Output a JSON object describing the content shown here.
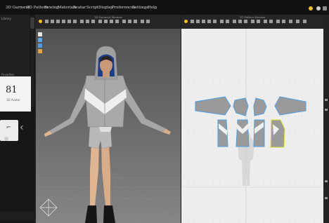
{
  "menu": [
    {
      "id": "3d-garment",
      "label": "3D Garment"
    },
    {
      "id": "2d-pattern",
      "label": "2D Pattern"
    },
    {
      "id": "sewing",
      "label": "Sewing"
    },
    {
      "id": "materials",
      "label": "Materials"
    },
    {
      "id": "avatar",
      "label": "Avatar"
    },
    {
      "id": "scripts",
      "label": "Script"
    },
    {
      "id": "display",
      "label": "Display"
    },
    {
      "id": "preferences",
      "label": "Preferences"
    },
    {
      "id": "settings",
      "label": "Settings"
    },
    {
      "id": "help",
      "label": "Help"
    }
  ],
  "left_panel": {
    "label_1": "Library",
    "label_2": "Favorites",
    "card_value": "81",
    "card_caption": "3D Avatar",
    "thumb_glyph": "⌐"
  },
  "window_3d": {
    "title": "3D Garment Window"
  },
  "window_2d": {
    "title": "2D Pattern Window"
  },
  "colors": {
    "accent_yellow": "#f2c01e",
    "selection_blue": "#4a9ee6",
    "pattern_fill": "#9a9a9a",
    "selected_outline": "#d7e230"
  }
}
